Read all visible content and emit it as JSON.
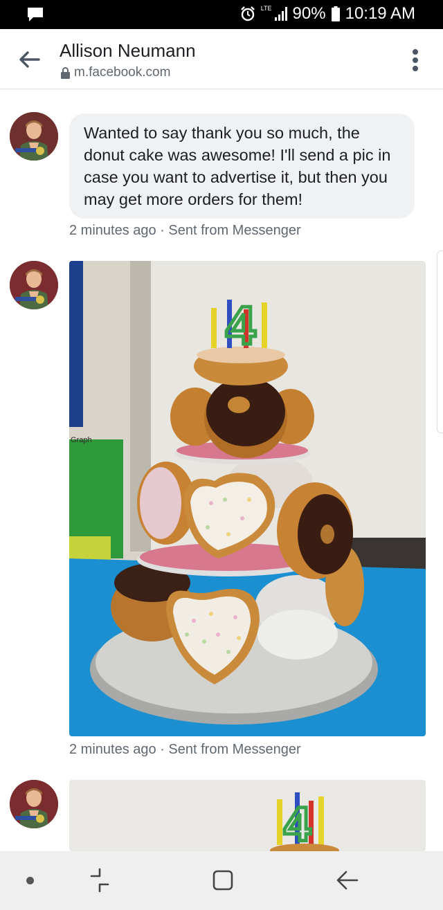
{
  "status_bar": {
    "network": "LTE",
    "battery": "90%",
    "time": "10:19 AM"
  },
  "app_bar": {
    "title": "Allison Neumann",
    "url": "m.facebook.com"
  },
  "messages": [
    {
      "text": "Wanted to say thank you so much, the donut cake was awesome! I'll send a pic in case you want to advertise it, but then you may get more orders for them!",
      "meta": "2 minutes ago · Sent from Messenger"
    },
    {
      "image": "donut-cake-photo",
      "meta": "2 minutes ago · Sent from Messenger"
    },
    {
      "image": "donut-cake-photo-partial"
    }
  ],
  "photo_text": {
    "wall_label": "Graph",
    "candle_number": "4"
  },
  "colors": {
    "status_bar_bg": "#000000",
    "bubble_bg": "#f0f1f3",
    "meta_text": "#606770",
    "nav_bg": "#efefef",
    "tablecloth": "#1b8fd0"
  },
  "nav_bar": {
    "items": [
      "nav-dot",
      "recents-icon",
      "home-icon",
      "back-icon"
    ]
  }
}
